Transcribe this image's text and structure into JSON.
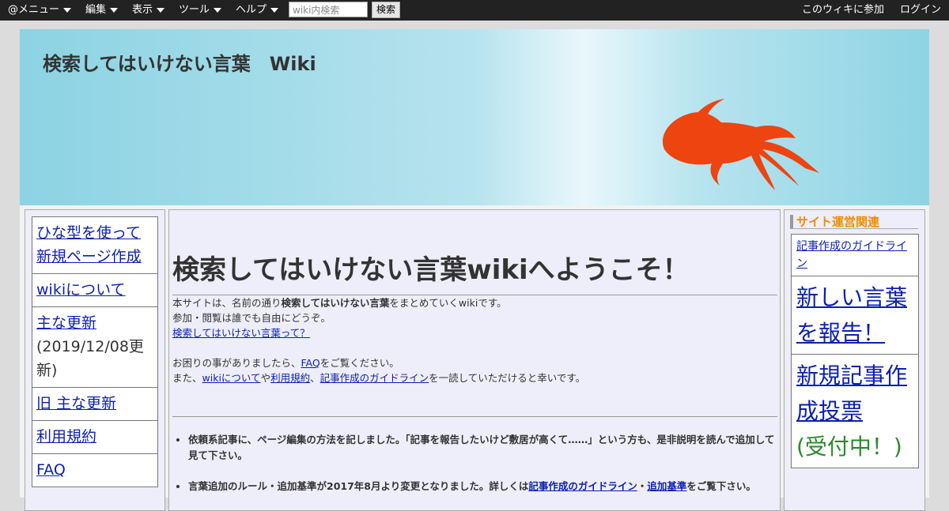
{
  "topbar": {
    "menus": [
      "@メニュー",
      "編集",
      "表示",
      "ツール",
      "ヘルプ"
    ],
    "search_placeholder": "wiki内検索",
    "search_button": "検索",
    "join": "このウィキに参加",
    "login": "ログイン"
  },
  "banner": {
    "title": "検索してはいけない言葉　Wiki"
  },
  "left_menu": {
    "items": [
      {
        "label": "ひな型を使って新規ページ作成"
      },
      {
        "label": "wikiについて"
      },
      {
        "label": "主な更新",
        "note": "(2019/12/08更新)"
      },
      {
        "label": "旧 主な更新"
      },
      {
        "label": "利用規約"
      },
      {
        "label": "FAQ"
      }
    ]
  },
  "main": {
    "heading": "検索してはいけない言葉wikiへようこそ！",
    "intro_1a": "本サイトは、名前の通り",
    "intro_1b": "検索してはいけない言葉",
    "intro_1c": "をまとめていくwikiです。",
    "intro_2": "参加・閲覧は誰でも自由にどうぞ。",
    "intro_link": "検索してはいけない言葉って？",
    "help_1a": "お困りの事がありましたら、",
    "help_1_link": "FAQ",
    "help_1b": "をご覧ください。",
    "help_2a": "また、",
    "help_2_link1": "wikiについて",
    "help_2b": "や",
    "help_2_link2": "利用規約",
    "help_2c": "、",
    "help_2_link3": "記事作成のガイドライン",
    "help_2d": "を一読していただけると幸いです。",
    "notice_1": "依頼系記事に、ページ編集の方法を記しました。「記事を報告したいけど敷居が高くて……」という方も、是非説明を読んで追加して見て下さい。",
    "notice_2a": "言葉追加のルール・追加基準が2017年8月より変更となりました。詳しくは",
    "notice_2_link1": "記事作成のガイドライン",
    "notice_2b": "・",
    "notice_2_link2": "追加基準",
    "notice_2c": "をご覧下さい。"
  },
  "right_menu": {
    "heading": "サイト運営関連",
    "guideline": "記事作成のガイドライン",
    "report": "新しい言葉を報告！",
    "vote_a": "新規記事作成投票",
    "vote_b": "(受付中！)"
  }
}
